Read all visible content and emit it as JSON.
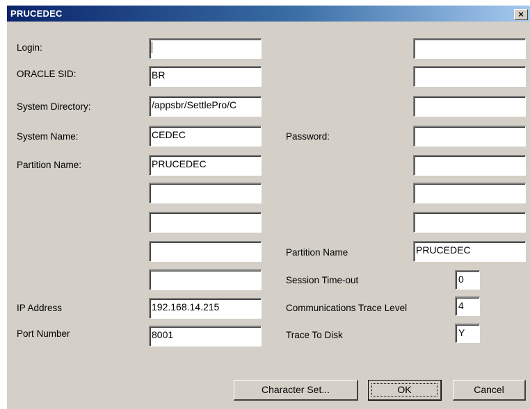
{
  "window": {
    "title": "PRUCEDEC",
    "close_glyph": "×"
  },
  "left_form": {
    "login_label": "Login:",
    "login_value": "",
    "oracle_sid_label": "ORACLE SID:",
    "oracle_sid_value": "BR",
    "system_directory_label": "System Directory:",
    "system_directory_value": "/appsbr/SettlePro/C",
    "system_name_label": "System Name:",
    "system_name_value": "CEDEC",
    "partition_name_label": "Partition Name:",
    "partition_name_value": "PRUCEDEC",
    "blank_fields": [
      "",
      "",
      "",
      ""
    ],
    "ip_address_label": "IP Address",
    "ip_address_value": "192.168.14.215",
    "port_number_label": "Port Number",
    "port_number_value": "8001"
  },
  "right_form": {
    "blank_fields_top": [
      "",
      "",
      ""
    ],
    "password_label": "Password:",
    "password_value": "",
    "blank_fields_bottom": [
      "",
      "",
      ""
    ],
    "partition_name_label": "Partition Name",
    "partition_name_value": "PRUCEDEC",
    "session_timeout_label": "Session Time-out",
    "session_timeout_value": "0",
    "comm_trace_level_label": "Communications Trace Level",
    "comm_trace_level_value": "4",
    "trace_to_disk_label": "Trace To Disk",
    "trace_to_disk_value": "Y"
  },
  "buttons": {
    "character_set": "Character Set...",
    "ok": "OK",
    "cancel": "Cancel"
  }
}
